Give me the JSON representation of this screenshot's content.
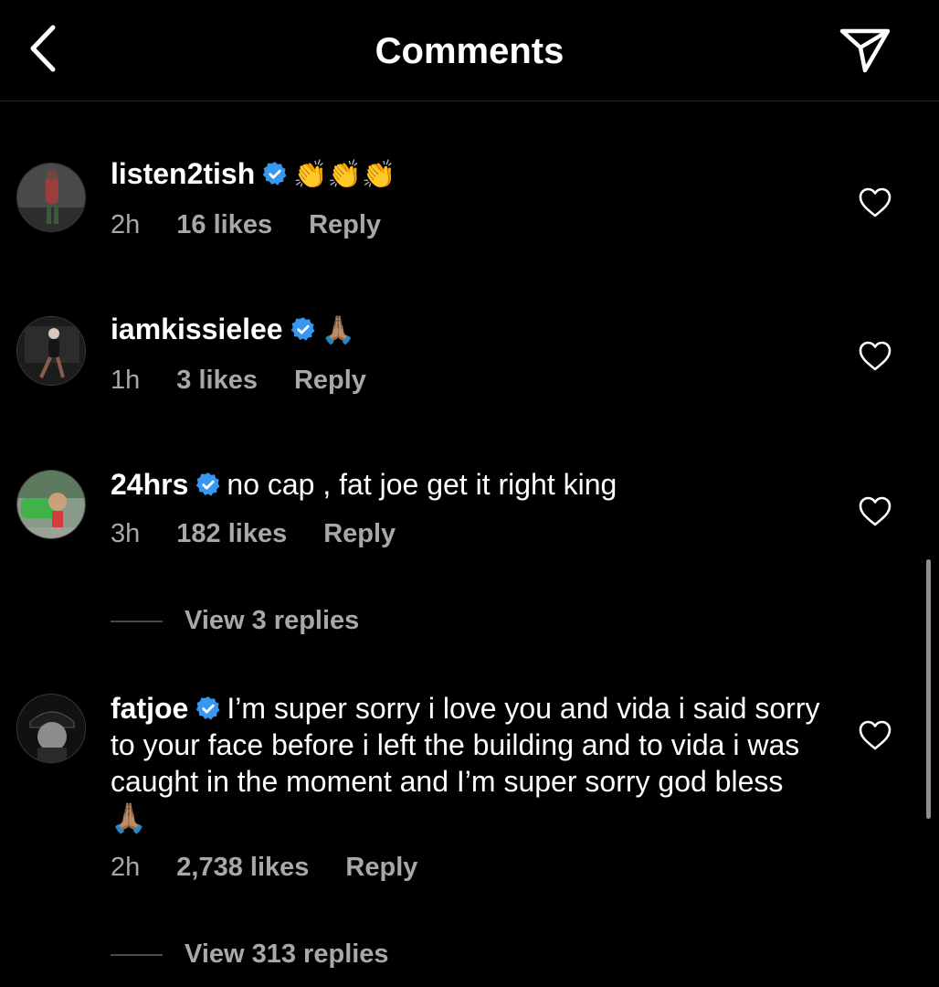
{
  "header": {
    "title": "Comments",
    "back_icon": "chevron-left-icon",
    "send_icon": "paper-plane-icon"
  },
  "colors": {
    "background": "#000000",
    "text": "#ffffff",
    "meta": "#a8a8a8",
    "verified": "#3897f0"
  },
  "comments": [
    {
      "username": "listen2tish",
      "verified": true,
      "text": "👏👏👏",
      "time": "2h",
      "likes": "16 likes",
      "reply": "Reply"
    },
    {
      "username": "iamkissielee",
      "verified": true,
      "text": "🙏🏽",
      "time": "1h",
      "likes": "3 likes",
      "reply": "Reply"
    },
    {
      "username": "24hrs",
      "verified": true,
      "text": "no cap , fat joe get it right king",
      "time": "3h",
      "likes": "182 likes",
      "reply": "Reply",
      "view_replies": "View 3 replies"
    },
    {
      "username": "fatjoe",
      "verified": true,
      "text": "I’m super sorry i love you and vida i said sorry to your face before i left the building and to vida i was caught in the moment and I’m super sorry god bless 🙏🏽",
      "time": "2h",
      "likes": "2,738 likes",
      "reply": "Reply",
      "view_replies": "View 313 replies"
    }
  ]
}
